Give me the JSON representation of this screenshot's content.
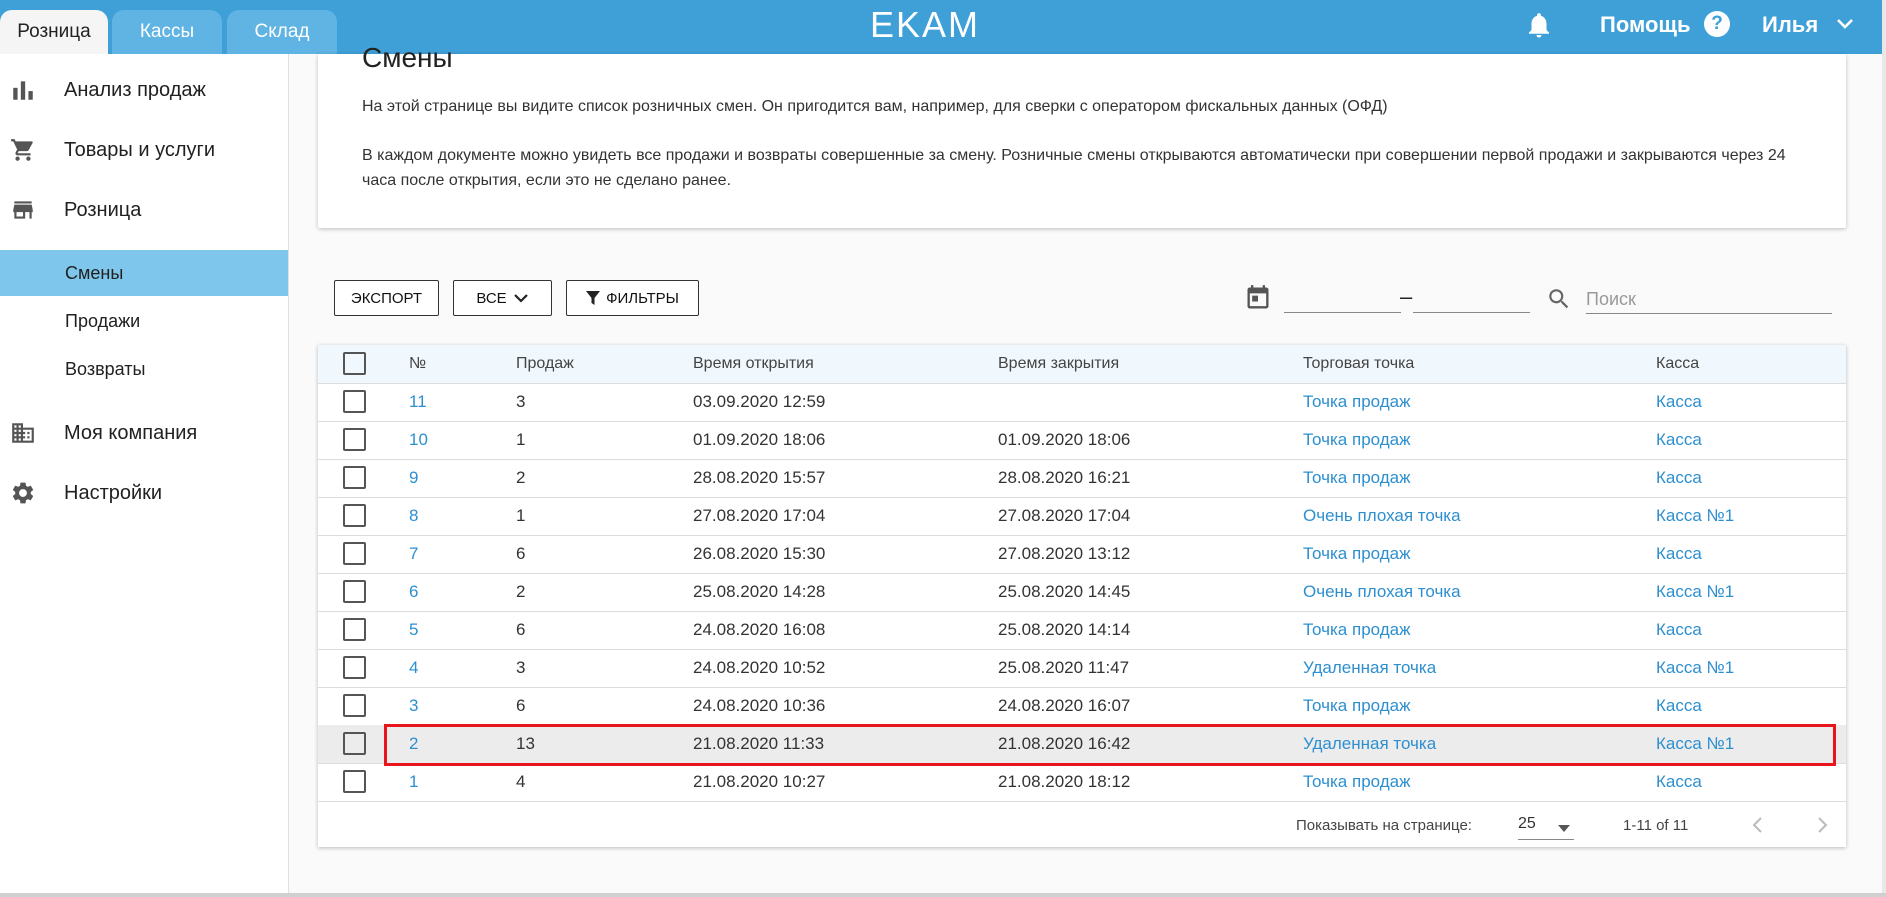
{
  "app": {
    "logo": "EKAM",
    "tabs": [
      {
        "label": "Розница"
      },
      {
        "label": "Кассы"
      },
      {
        "label": "Склад"
      }
    ],
    "help_label": "Помощь",
    "help_icon_glyph": "?",
    "user_name": "Илья"
  },
  "sidebar": {
    "items": [
      {
        "label": "Анализ продаж",
        "icon": "bar-chart-icon"
      },
      {
        "label": "Товары и услуги",
        "icon": "cart-icon"
      },
      {
        "label": "Розница",
        "icon": "store-icon"
      },
      {
        "label": "Моя компания",
        "icon": "building-icon"
      },
      {
        "label": "Настройки",
        "icon": "gear-icon"
      }
    ],
    "sub_items": [
      {
        "label": "Смены",
        "active": true
      },
      {
        "label": "Продажи",
        "active": false
      },
      {
        "label": "Возвраты",
        "active": false
      }
    ]
  },
  "info": {
    "title": "Смены",
    "p1": "На этой странице вы видите список розничных смен. Он пригодится вам, например, для сверки с оператором фискальных данных (ОФД)",
    "p2": "В каждом документе можно увидеть все продажи и возвраты совершенные за смену. Розничные смены открываются автоматически при совершении первой продажи и закрываются через 24 часа после открытия, если это не сделано ранее."
  },
  "toolbar": {
    "export_label": "ЭКСПОРТ",
    "all_label": "ВСЕ",
    "filters_label": "ФИЛЬТРЫ",
    "date_dash": "–",
    "search_placeholder": "Поиск"
  },
  "table": {
    "headers": [
      "№",
      "Продаж",
      "Время открытия",
      "Время закрытия",
      "Торговая точка",
      "Касса"
    ],
    "rows": [
      {
        "num": "11",
        "sales": "3",
        "open": "03.09.2020 12:59",
        "close": "",
        "point": "Точка продаж",
        "kassa": "Касса"
      },
      {
        "num": "10",
        "sales": "1",
        "open": "01.09.2020 18:06",
        "close": "01.09.2020 18:06",
        "point": "Точка продаж",
        "kassa": "Касса"
      },
      {
        "num": "9",
        "sales": "2",
        "open": "28.08.2020 15:57",
        "close": "28.08.2020 16:21",
        "point": "Точка продаж",
        "kassa": "Касса"
      },
      {
        "num": "8",
        "sales": "1",
        "open": "27.08.2020 17:04",
        "close": "27.08.2020 17:04",
        "point": "Очень плохая точка",
        "kassa": "Касса №1"
      },
      {
        "num": "7",
        "sales": "6",
        "open": "26.08.2020 15:30",
        "close": "27.08.2020 13:12",
        "point": "Точка продаж",
        "kassa": "Касса"
      },
      {
        "num": "6",
        "sales": "2",
        "open": "25.08.2020 14:28",
        "close": "25.08.2020 14:45",
        "point": "Очень плохая точка",
        "kassa": "Касса №1"
      },
      {
        "num": "5",
        "sales": "6",
        "open": "24.08.2020 16:08",
        "close": "25.08.2020 14:14",
        "point": "Точка продаж",
        "kassa": "Касса"
      },
      {
        "num": "4",
        "sales": "3",
        "open": "24.08.2020 10:52",
        "close": "25.08.2020 11:47",
        "point": "Удаленная точка",
        "kassa": "Касса №1"
      },
      {
        "num": "3",
        "sales": "6",
        "open": "24.08.2020 10:36",
        "close": "24.08.2020 16:07",
        "point": "Точка продаж",
        "kassa": "Касса"
      },
      {
        "num": "2",
        "sales": "13",
        "open": "21.08.2020 11:33",
        "close": "21.08.2020 16:42",
        "point": "Удаленная точка",
        "kassa": "Касса №1",
        "highlighted": true
      },
      {
        "num": "1",
        "sales": "4",
        "open": "21.08.2020 10:27",
        "close": "21.08.2020 18:12",
        "point": "Точка продаж",
        "kassa": "Касса"
      }
    ],
    "pager": {
      "per_page_label": "Показывать на странице:",
      "per_page_value": "25",
      "range": "1-11 of 11"
    }
  },
  "colors": {
    "topbar": "#3fa0d8",
    "link": "#2d8fd0",
    "active_sub": "#7ec6ec",
    "highlight_box": "#e8161c"
  }
}
